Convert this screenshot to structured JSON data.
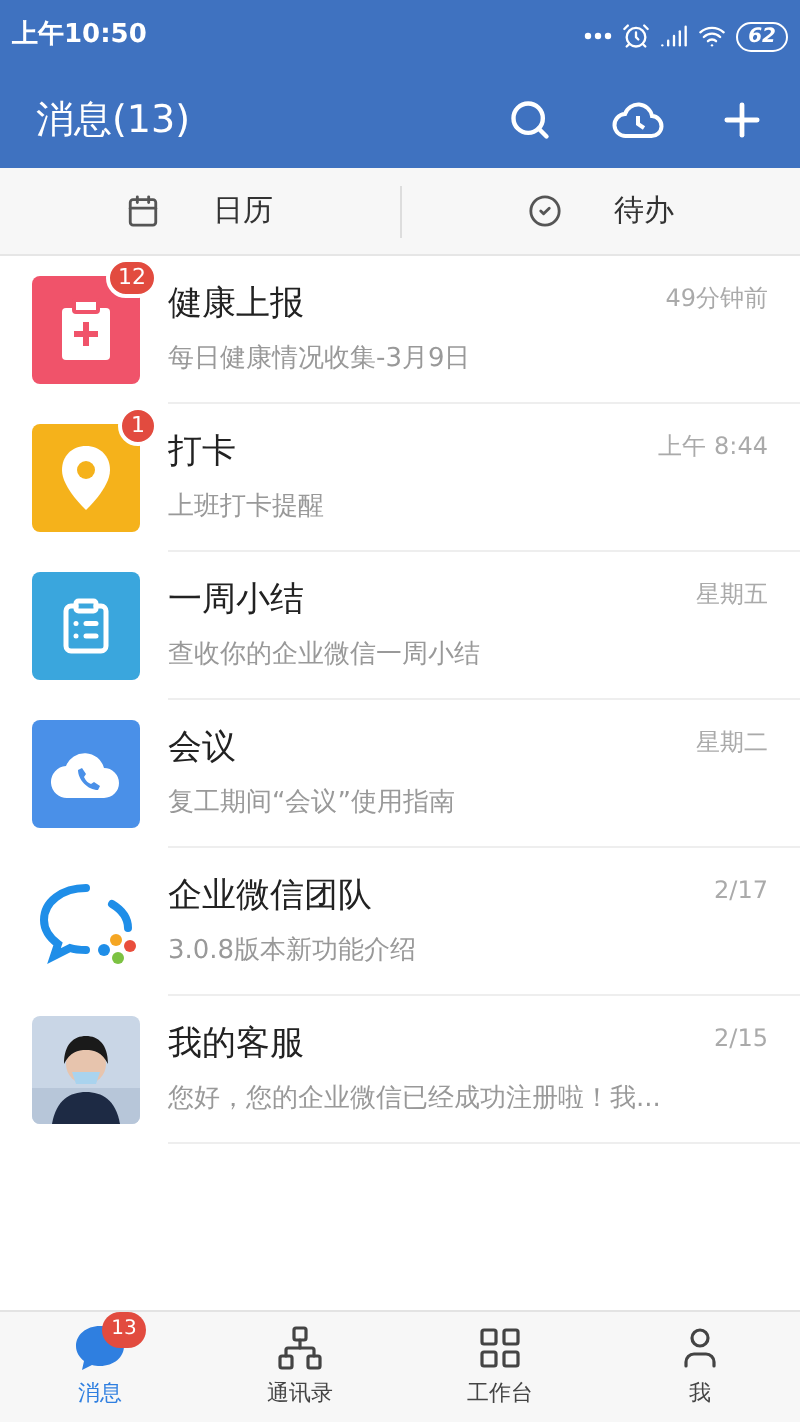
{
  "status_bar": {
    "time": "上午10:50",
    "battery": "62"
  },
  "header": {
    "title": "消息(13)"
  },
  "quick_tabs": [
    {
      "kind": "calendar",
      "label": "日历"
    },
    {
      "kind": "todo",
      "label": "待办"
    }
  ],
  "conversations": [
    {
      "kind": "health",
      "name": "健康上报",
      "preview": "每日健康情况收集-3月9日",
      "time": "49分钟前",
      "badge": "12"
    },
    {
      "kind": "checkin",
      "name": "打卡",
      "preview": "上班打卡提醒",
      "time": "上午 8:44",
      "badge": "1"
    },
    {
      "kind": "summary",
      "name": "一周小结",
      "preview": "查收你的企业微信一周小结",
      "time": "星期五"
    },
    {
      "kind": "meeting",
      "name": "会议",
      "preview": "复工期间“会议”使用指南",
      "time": "星期二"
    },
    {
      "kind": "team",
      "name": "企业微信团队",
      "preview": "3.0.8版本新功能介绍",
      "time": "2/17"
    },
    {
      "kind": "picture",
      "name": "我的客服",
      "preview": "您好，您的企业微信已经成功注册啦！我...",
      "time": "2/15"
    }
  ],
  "bottom_nav": [
    {
      "kind": "messages",
      "label": "消息",
      "selected": true,
      "badge": "13"
    },
    {
      "kind": "contacts",
      "label": "通讯录",
      "selected": false
    },
    {
      "kind": "workbench",
      "label": "工作台",
      "selected": false
    },
    {
      "kind": "me",
      "label": "我",
      "selected": false
    }
  ]
}
